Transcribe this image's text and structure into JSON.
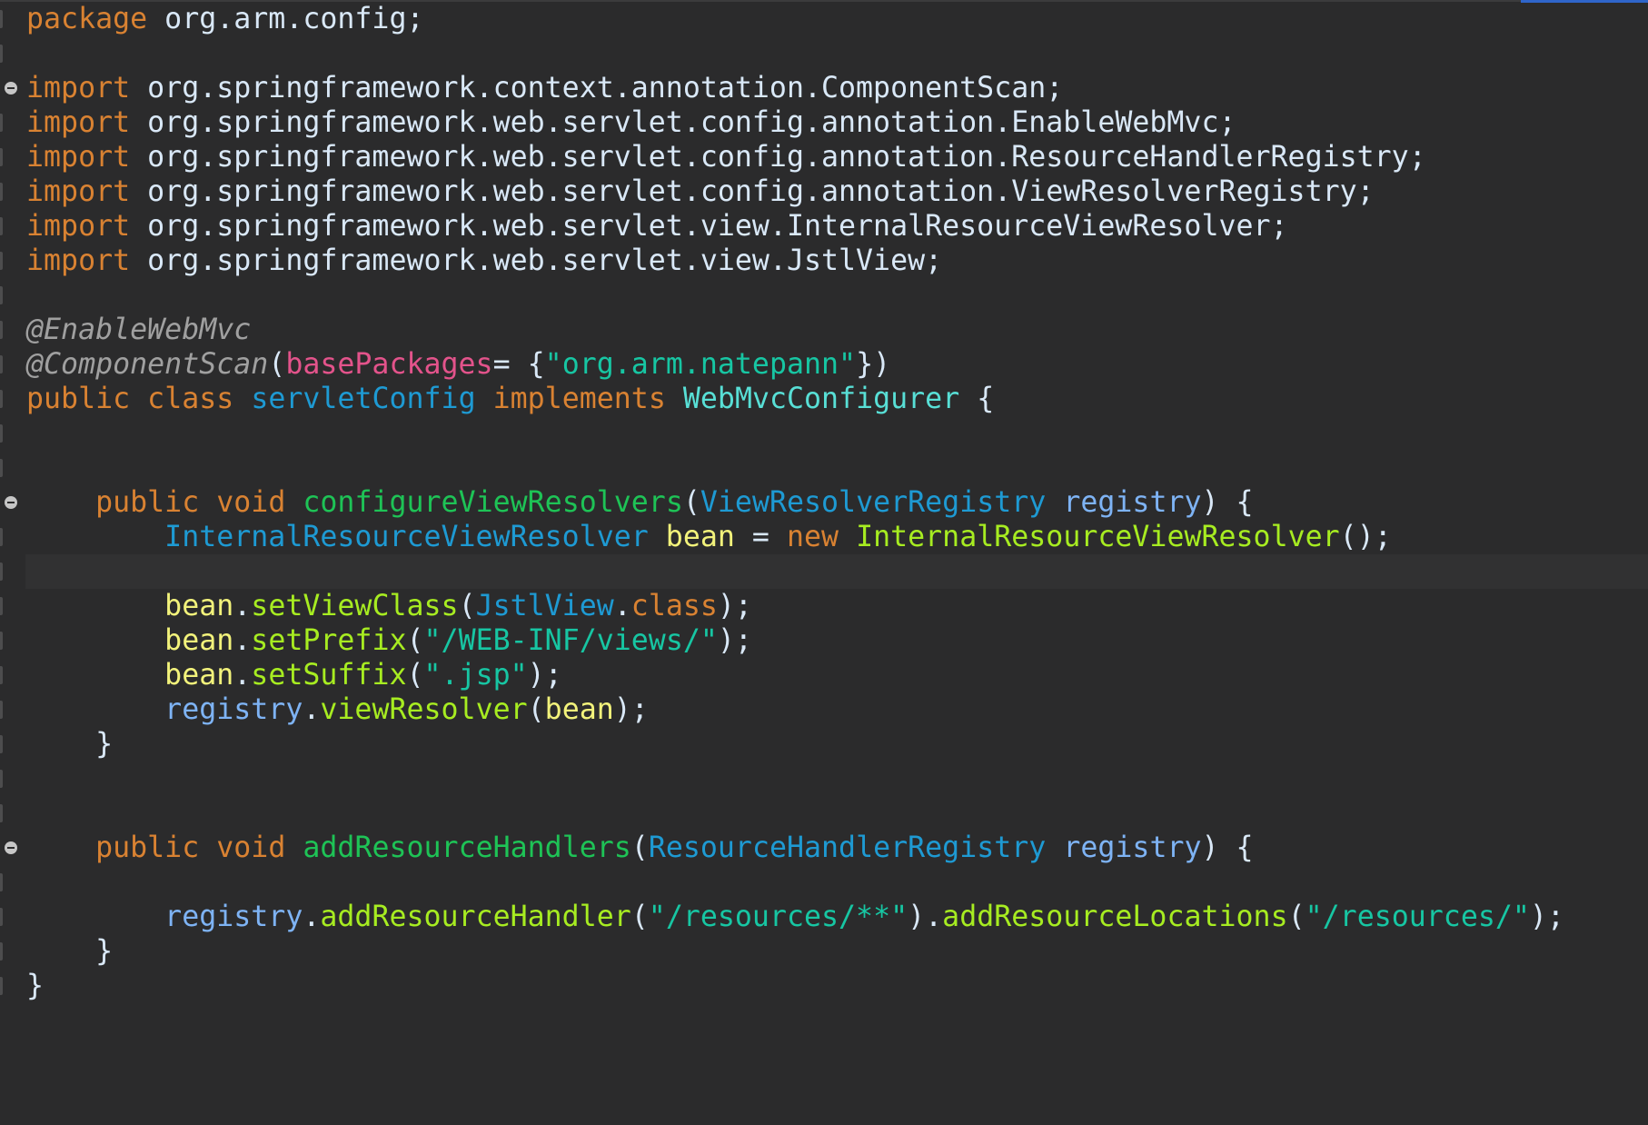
{
  "editor": {
    "language": "java",
    "lines": [
      [
        {
          "t": "package",
          "c": "kw"
        },
        {
          "t": " org.arm.config;",
          "c": "plain"
        }
      ],
      [],
      [
        {
          "t": "import",
          "c": "kw"
        },
        {
          "t": " org.springframework.context.annotation.ComponentScan;",
          "c": "plain"
        }
      ],
      [
        {
          "t": "import",
          "c": "kw"
        },
        {
          "t": " org.springframework.web.servlet.config.annotation.EnableWebMvc;",
          "c": "plain"
        }
      ],
      [
        {
          "t": "import",
          "c": "kw"
        },
        {
          "t": " org.springframework.web.servlet.config.annotation.ResourceHandlerRegistry;",
          "c": "plain"
        }
      ],
      [
        {
          "t": "import",
          "c": "kw"
        },
        {
          "t": " org.springframework.web.servlet.config.annotation.ViewResolverRegistry;",
          "c": "plain"
        }
      ],
      [
        {
          "t": "import",
          "c": "kw"
        },
        {
          "t": " org.springframework.web.servlet.view.InternalResourceViewResolver;",
          "c": "plain"
        }
      ],
      [
        {
          "t": "import",
          "c": "kw"
        },
        {
          "t": " org.springframework.web.servlet.view.JstlView;",
          "c": "plain"
        }
      ],
      [],
      [
        {
          "t": "@EnableWebMvc",
          "c": "ann"
        }
      ],
      [
        {
          "t": "@ComponentScan",
          "c": "ann"
        },
        {
          "t": "(",
          "c": "plain"
        },
        {
          "t": "basePackages",
          "c": "attr"
        },
        {
          "t": "= {",
          "c": "plain"
        },
        {
          "t": "\"org.arm.natepann\"",
          "c": "str"
        },
        {
          "t": "})",
          "c": "plain"
        }
      ],
      [
        {
          "t": "public",
          "c": "kw"
        },
        {
          "t": " ",
          "c": "plain"
        },
        {
          "t": "class",
          "c": "kw"
        },
        {
          "t": " ",
          "c": "plain"
        },
        {
          "t": "servletConfig",
          "c": "type"
        },
        {
          "t": " ",
          "c": "plain"
        },
        {
          "t": "implements",
          "c": "kw"
        },
        {
          "t": " ",
          "c": "plain"
        },
        {
          "t": "WebMvcConfigurer",
          "c": "itype"
        },
        {
          "t": " {",
          "c": "plain"
        }
      ],
      [],
      [],
      [
        {
          "t": "    ",
          "c": "plain"
        },
        {
          "t": "public",
          "c": "kw"
        },
        {
          "t": " ",
          "c": "plain"
        },
        {
          "t": "void",
          "c": "kw"
        },
        {
          "t": " ",
          "c": "plain"
        },
        {
          "t": "configureViewResolvers",
          "c": "mdecl"
        },
        {
          "t": "(",
          "c": "plain"
        },
        {
          "t": "ViewResolverRegistry",
          "c": "type"
        },
        {
          "t": " ",
          "c": "plain"
        },
        {
          "t": "registry",
          "c": "field"
        },
        {
          "t": ") {",
          "c": "plain"
        }
      ],
      [
        {
          "t": "        ",
          "c": "plain"
        },
        {
          "t": "InternalResourceViewResolver",
          "c": "type"
        },
        {
          "t": " ",
          "c": "plain"
        },
        {
          "t": "bean",
          "c": "var"
        },
        {
          "t": " = ",
          "c": "plain"
        },
        {
          "t": "new",
          "c": "kw"
        },
        {
          "t": " ",
          "c": "plain"
        },
        {
          "t": "InternalResourceViewResolver",
          "c": "fn"
        },
        {
          "t": "();",
          "c": "plain"
        }
      ],
      [],
      [
        {
          "t": "        ",
          "c": "plain"
        },
        {
          "t": "bean",
          "c": "var"
        },
        {
          "t": ".",
          "c": "plain"
        },
        {
          "t": "setViewClass",
          "c": "fn"
        },
        {
          "t": "(",
          "c": "plain"
        },
        {
          "t": "JstlView",
          "c": "type"
        },
        {
          "t": ".",
          "c": "plain"
        },
        {
          "t": "class",
          "c": "kw"
        },
        {
          "t": ");",
          "c": "plain"
        }
      ],
      [
        {
          "t": "        ",
          "c": "plain"
        },
        {
          "t": "bean",
          "c": "var"
        },
        {
          "t": ".",
          "c": "plain"
        },
        {
          "t": "setPrefix",
          "c": "fn"
        },
        {
          "t": "(",
          "c": "plain"
        },
        {
          "t": "\"/WEB-INF/views/\"",
          "c": "str"
        },
        {
          "t": ");",
          "c": "plain"
        }
      ],
      [
        {
          "t": "        ",
          "c": "plain"
        },
        {
          "t": "bean",
          "c": "var"
        },
        {
          "t": ".",
          "c": "plain"
        },
        {
          "t": "setSuffix",
          "c": "fn"
        },
        {
          "t": "(",
          "c": "plain"
        },
        {
          "t": "\".jsp\"",
          "c": "str"
        },
        {
          "t": ");",
          "c": "plain"
        }
      ],
      [
        {
          "t": "        ",
          "c": "plain"
        },
        {
          "t": "registry",
          "c": "field"
        },
        {
          "t": ".",
          "c": "plain"
        },
        {
          "t": "viewResolver",
          "c": "fn"
        },
        {
          "t": "(",
          "c": "plain"
        },
        {
          "t": "bean",
          "c": "var"
        },
        {
          "t": ");",
          "c": "plain"
        }
      ],
      [
        {
          "t": "    }",
          "c": "plain"
        }
      ],
      [],
      [],
      [
        {
          "t": "    ",
          "c": "plain"
        },
        {
          "t": "public",
          "c": "kw"
        },
        {
          "t": " ",
          "c": "plain"
        },
        {
          "t": "void",
          "c": "kw"
        },
        {
          "t": " ",
          "c": "plain"
        },
        {
          "t": "addResourceHandlers",
          "c": "mdecl"
        },
        {
          "t": "(",
          "c": "plain"
        },
        {
          "t": "ResourceHandlerRegistry",
          "c": "type"
        },
        {
          "t": " ",
          "c": "plain"
        },
        {
          "t": "registry",
          "c": "field"
        },
        {
          "t": ") {",
          "c": "plain"
        }
      ],
      [],
      [
        {
          "t": "        ",
          "c": "plain"
        },
        {
          "t": "registry",
          "c": "field"
        },
        {
          "t": ".",
          "c": "plain"
        },
        {
          "t": "addResourceHandler",
          "c": "fn"
        },
        {
          "t": "(",
          "c": "plain"
        },
        {
          "t": "\"/resources/**\"",
          "c": "str"
        },
        {
          "t": ").",
          "c": "plain"
        },
        {
          "t": "addResourceLocations",
          "c": "fn"
        },
        {
          "t": "(",
          "c": "plain"
        },
        {
          "t": "\"/resources/\"",
          "c": "str"
        },
        {
          "t": ");",
          "c": "plain"
        }
      ],
      [
        {
          "t": "    }",
          "c": "plain"
        }
      ],
      [
        {
          "t": "}",
          "c": "plain"
        }
      ]
    ],
    "fold_lines": [
      2,
      14,
      24
    ],
    "current_line": 16
  }
}
